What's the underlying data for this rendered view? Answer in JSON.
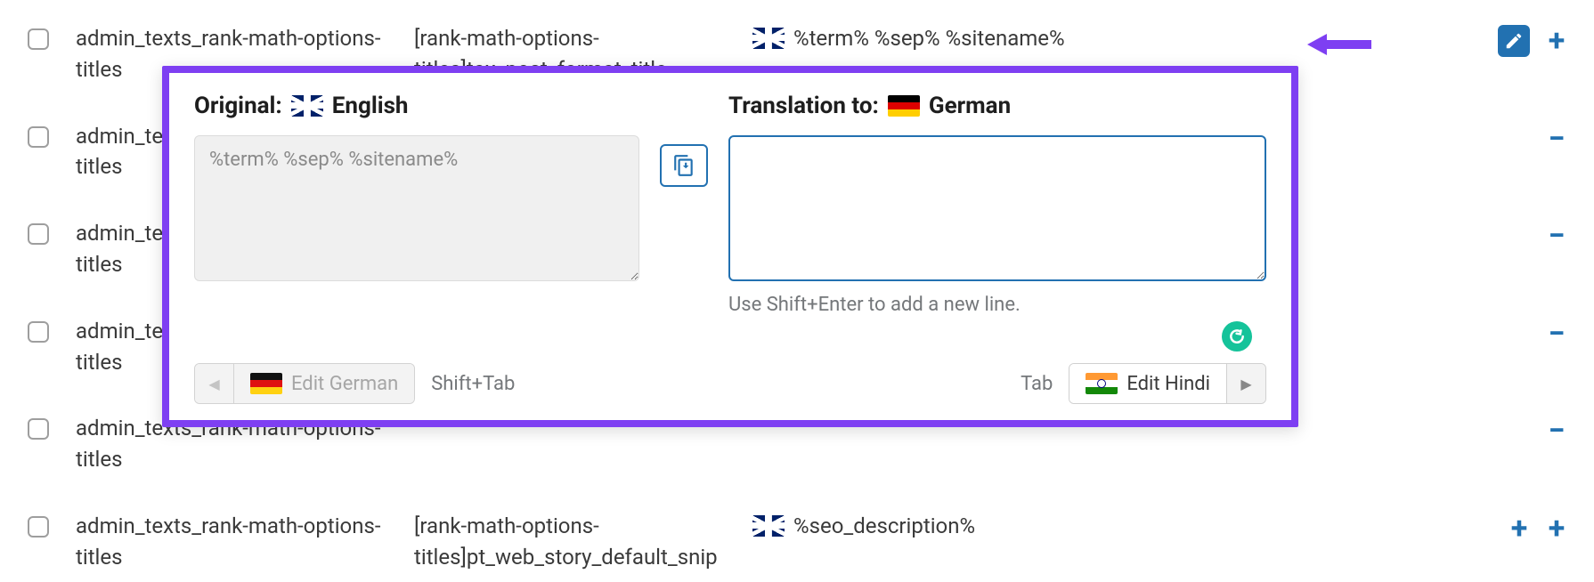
{
  "rows": [
    {
      "name": "admin_texts_rank-math-options-titles",
      "context": "[rank-math-options-titles]tax_post_format_title",
      "original": "%term% %sep% %sitename%",
      "actions": "edit-plus"
    },
    {
      "name": "admin_texts_rank-math-options-titles",
      "context": "",
      "original": "",
      "actions": "plus"
    },
    {
      "name": "admin_texts_rank-math-options-titles",
      "context": "",
      "original": "",
      "actions": "plus"
    },
    {
      "name": "admin_texts_rank-math-options-titles",
      "context": "",
      "original": "",
      "actions": "plus"
    },
    {
      "name": "admin_texts_rank-math-options-titles",
      "context": "",
      "original": "",
      "actions": "plus"
    },
    {
      "name": "admin_texts_rank-math-options-titles",
      "context": "[rank-math-options-titles]pt_web_story_default_snip",
      "original": "%seo_description%",
      "actions": "plus-plus"
    }
  ],
  "popup": {
    "original_label_prefix": "Original:",
    "original_lang": "English",
    "translation_label_prefix": "Translation to:",
    "translation_lang": "German",
    "original_text": "%term% %sep% %sitename%",
    "translation_text": "",
    "hint": "Use Shift+Enter to add a new line.",
    "prev_lang_label": "Edit German",
    "next_lang_label": "Edit Hindi",
    "prev_kbd": "Shift+Tab",
    "next_kbd": "Tab"
  }
}
